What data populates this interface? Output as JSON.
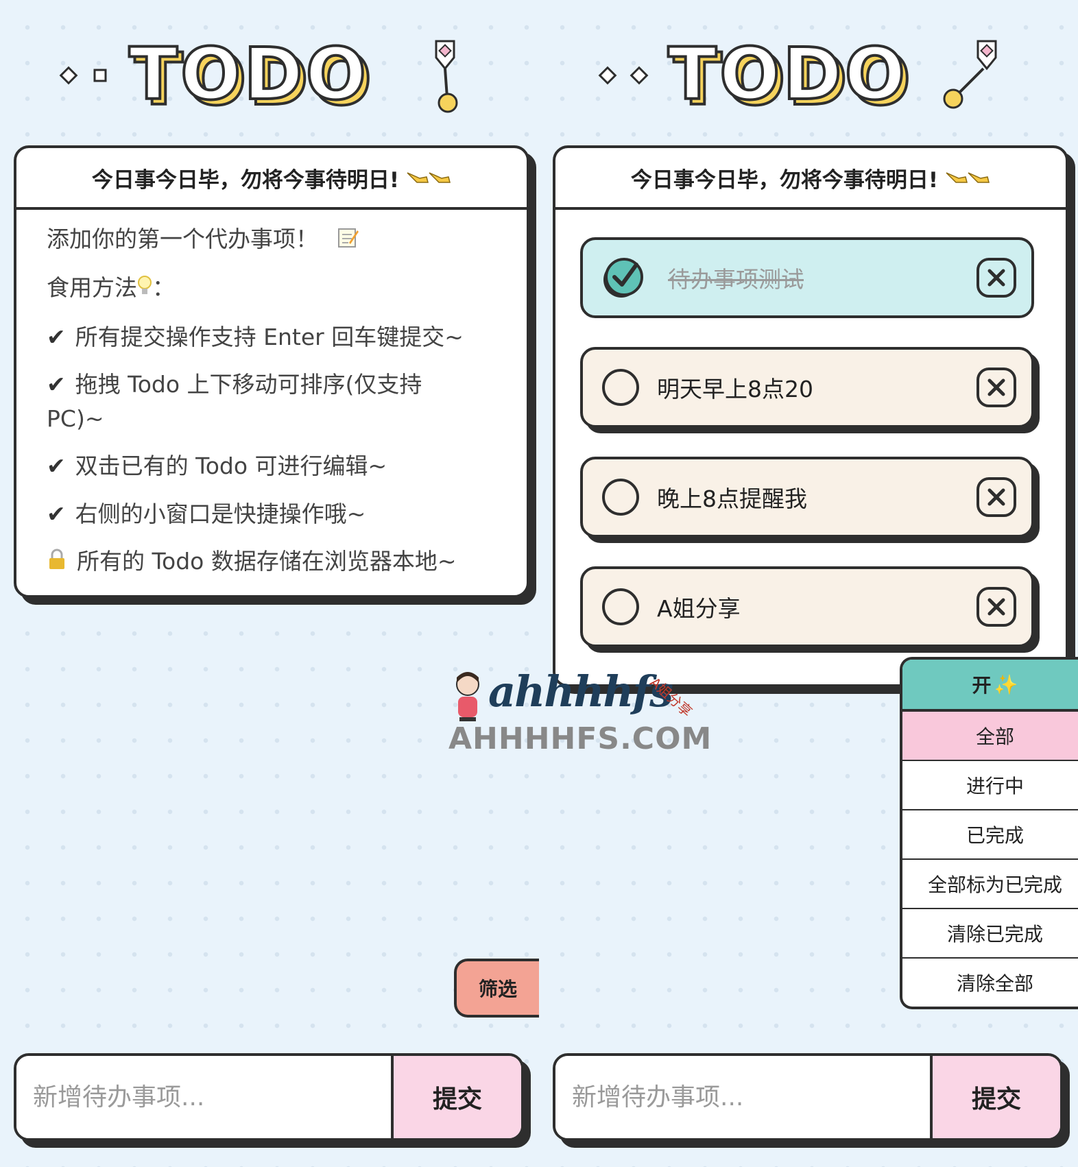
{
  "logo_text": "TODO",
  "left_panel": {
    "header": "今日事今日毕，勿将今事待明日!",
    "help_lines": [
      "添加你的第一个代办事项！",
      "食用方法",
      "所有提交操作支持 Enter 回车键提交~",
      "拖拽 Todo 上下移动可排序(仅支持 PC)~",
      "双击已有的 Todo 可进行编辑~",
      "右侧的小窗口是快捷操作哦~",
      "所有的 Todo 数据存储在浏览器本地~"
    ],
    "check_mark": "✔"
  },
  "right_panel": {
    "header": "今日事今日毕，勿将今事待明日!",
    "todos": [
      {
        "text": "待办事项测试",
        "done": true
      },
      {
        "text": "明天早上8点20",
        "done": false
      },
      {
        "text": "晚上8点提醒我",
        "done": false
      },
      {
        "text": "A姐分享",
        "done": false
      }
    ]
  },
  "filter_button": "筛选",
  "quick_menu": {
    "header": "开",
    "items": [
      "全部",
      "进行中",
      "已完成",
      "全部标为已完成",
      "清除已完成",
      "清除全部"
    ],
    "active_index": 0
  },
  "input_left": {
    "placeholder": "新增待办事项...",
    "submit": "提交"
  },
  "input_right": {
    "placeholder": "新增待办事项...",
    "submit": "提交"
  },
  "watermark": {
    "script": "ahhhhfs",
    "site": "AHHHHFS.COM",
    "tag": "A姐分享"
  },
  "colors": {
    "background": "#e9f3fb",
    "border": "#2e2e2e",
    "done_item": "#cfeff0",
    "pending_item": "#f9f1e7",
    "menu_header": "#6fc9bf",
    "menu_active": "#f9c8db",
    "filter_button": "#f3a394",
    "submit_button": "#fad6e6",
    "logo_yellow": "#f6d35c",
    "check_teal": "#5fc2b6"
  },
  "icons": [
    "diamond-icon",
    "square-icon",
    "pin-icon",
    "check-icon",
    "close-icon",
    "memo-icon",
    "bulb-icon",
    "lock-icon",
    "pointing-hand-icon",
    "sparkle-icon"
  ]
}
